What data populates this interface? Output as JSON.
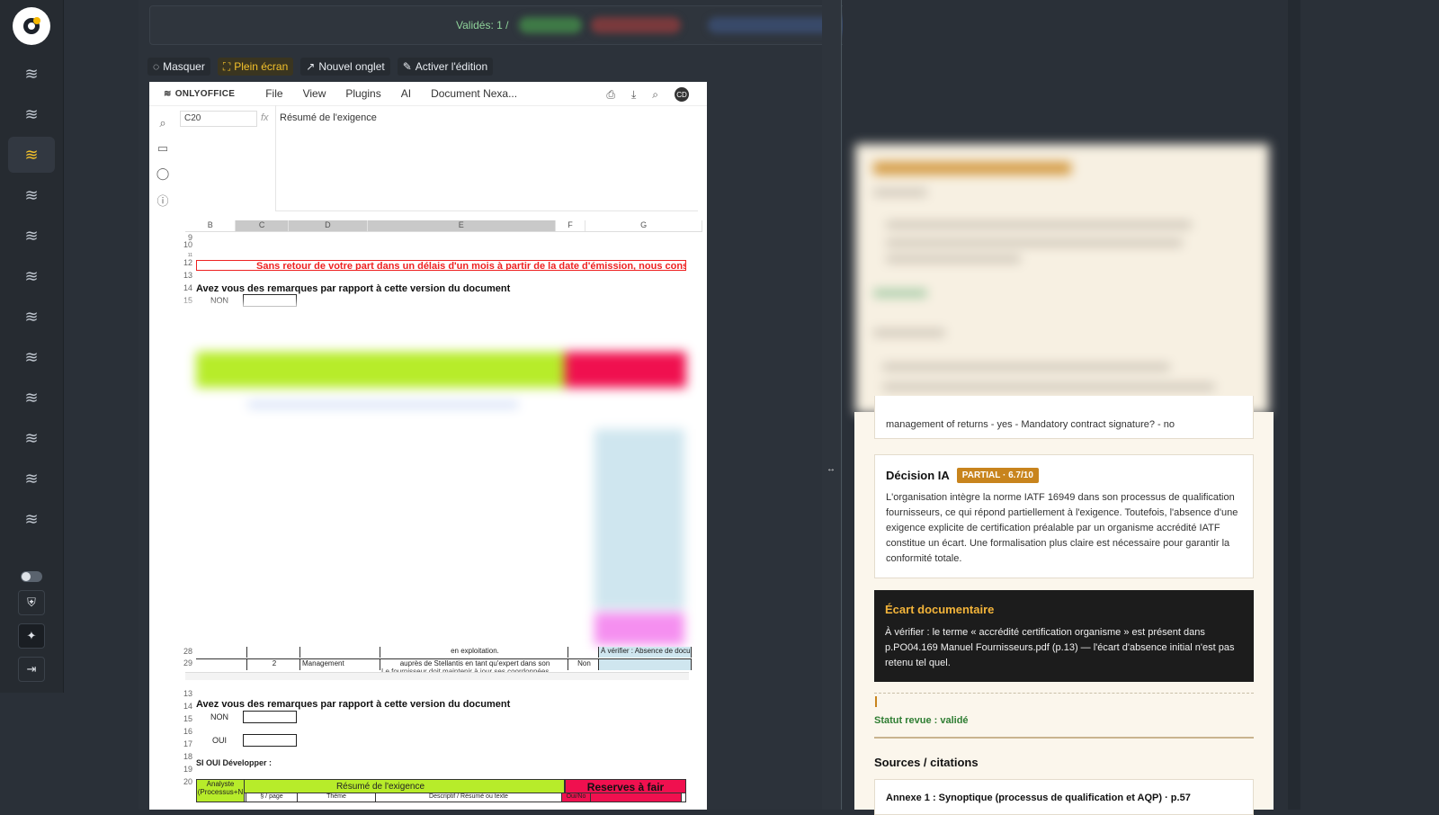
{
  "topbar": {
    "valid_text": "Validés: 1 /"
  },
  "toolbar": {
    "hide": "Masquer",
    "fullscreen": "Plein écran",
    "new_tab": "Nouvel onglet",
    "edit": "Activer l'édition"
  },
  "editor": {
    "brand": "ONLYOFFICE",
    "menu": [
      "File",
      "View",
      "Plugins",
      "AI",
      "Document Nexa..."
    ],
    "avatar": "CD",
    "cell_ref": "C20",
    "formula": "Résumé de l'exigence",
    "columns": [
      "B",
      "C",
      "D",
      "E",
      "F",
      "G"
    ],
    "rows_top": [
      "9",
      "10",
      "11",
      "12",
      "13",
      "14",
      "15"
    ],
    "red_banner": "Sans retour de votre part dans un délais d'un mois à partir de la date d'émission,  nous consid",
    "question": "Avez vous des remarques par rapport à cette version du  document",
    "non": "NON",
    "oui": "OUI",
    "rows_bottom": [
      "28",
      "29",
      "13",
      "14",
      "15",
      "16",
      "17",
      "18",
      "19",
      "20"
    ],
    "row28_text": "en exploitation.",
    "row28_verify": "À vérifier : Absence de documen",
    "row29_num": "2",
    "row29_theme": "Management",
    "row29_text": "auprès de Stellantis en tant qu'expert dans son",
    "row29_status": "Non",
    "row29_overflow": "Le fournisseur doit maintenir à jour ses coordonnées",
    "develop": "SI OUI Développer :",
    "analyste": "Analyste",
    "analyste_sub": "(Processus+N",
    "resume_head": "Résumé de l'exigence",
    "reserves_head": "Reserves à fair",
    "sub_cols": [
      "§ / page",
      "Thème",
      "Descriptif / Résumé ou texte",
      "Oui/No"
    ]
  },
  "right": {
    "top_text": "management of returns - yes - Mandatory contract signature? - no",
    "decision_title": "Décision IA",
    "decision_badge": "PARTIAL · 6.7/10",
    "decision_text": "L'organisation intègre la norme IATF 16949 dans son processus de qualification fournisseurs, ce qui répond partiellement à l'exigence. Toutefois, l'absence d'une exigence explicite de certification préalable par un organisme accrédité IATF constitue un écart. Une formalisation plus claire est nécessaire pour garantir la conformité totale.",
    "ecart_title": "Écart documentaire",
    "ecart_text": "À vérifier : le terme « accrédité certification organisme » est présent dans p.PO04.169 Manuel Fournisseurs.pdf (p.13) — l'écart d'absence initial n'est pas retenu tel quel.",
    "statut": "Statut revue : validé",
    "sources_title": "Sources / citations",
    "source_1": "Annexe 1 : Synoptique (processus de qualification et AQP) · p.57"
  },
  "colors": {
    "accent": "#f3c12b",
    "badge": "#c8841d",
    "success": "#2e7d32",
    "banner_red": "#e22222"
  }
}
